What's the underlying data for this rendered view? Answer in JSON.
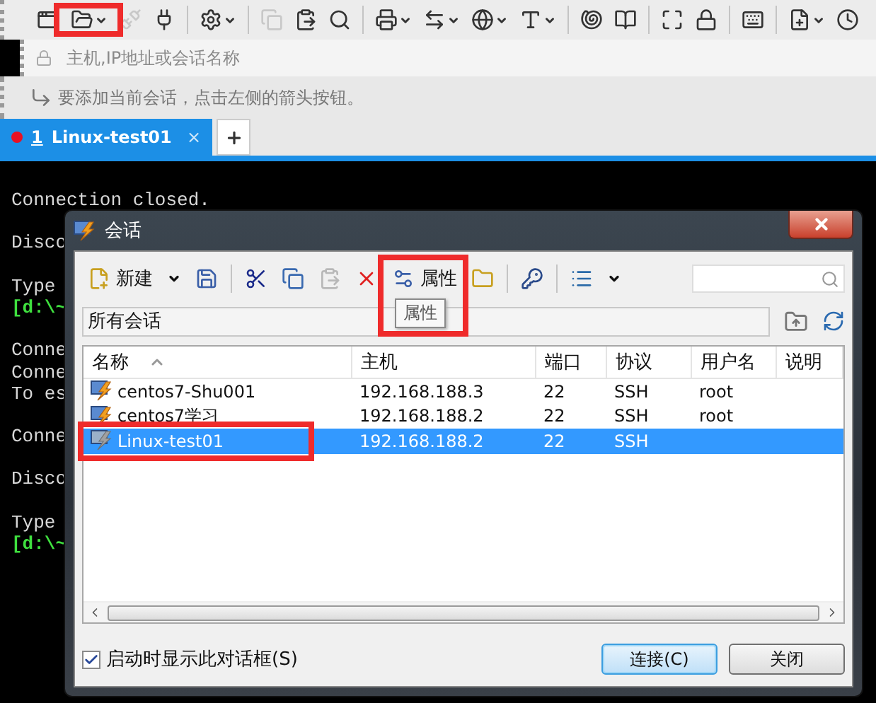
{
  "main_toolbar": [
    {
      "kind": "button",
      "disabled": false,
      "menu": false,
      "highlighted": false
    },
    {
      "kind": "button",
      "disabled": false,
      "menu": true,
      "highlighted": true
    },
    {
      "kind": "button",
      "disabled": true,
      "menu": false,
      "highlighted": false
    },
    {
      "kind": "button",
      "disabled": false,
      "menu": false,
      "highlighted": false
    },
    {
      "kind": "separator"
    },
    {
      "kind": "button",
      "disabled": false,
      "menu": true,
      "highlighted": false
    },
    {
      "kind": "separator"
    },
    {
      "kind": "button",
      "disabled": true,
      "menu": false,
      "highlighted": false
    },
    {
      "kind": "button",
      "disabled": false,
      "menu": false,
      "highlighted": false
    },
    {
      "kind": "button",
      "disabled": false,
      "menu": false,
      "highlighted": false
    },
    {
      "kind": "separator"
    },
    {
      "kind": "button",
      "disabled": false,
      "menu": true,
      "highlighted": false
    },
    {
      "kind": "button",
      "disabled": false,
      "menu": true,
      "highlighted": false
    },
    {
      "kind": "button",
      "disabled": false,
      "menu": true,
      "highlighted": false
    },
    {
      "kind": "button",
      "disabled": false,
      "menu": true,
      "highlighted": false
    },
    {
      "kind": "separator"
    },
    {
      "kind": "button",
      "disabled": false,
      "menu": false,
      "highlighted": false
    },
    {
      "kind": "button",
      "disabled": false,
      "menu": false,
      "highlighted": false
    },
    {
      "kind": "separator"
    },
    {
      "kind": "button",
      "disabled": false,
      "menu": false,
      "highlighted": false
    },
    {
      "kind": "button",
      "disabled": false,
      "menu": false,
      "highlighted": false
    },
    {
      "kind": "separator"
    },
    {
      "kind": "button",
      "disabled": false,
      "menu": false,
      "highlighted": false
    },
    {
      "kind": "separator"
    },
    {
      "kind": "button",
      "disabled": false,
      "menu": true,
      "highlighted": false
    },
    {
      "kind": "button",
      "disabled": false,
      "menu": false,
      "highlighted": false
    }
  ],
  "address_bar": {
    "placeholder": "主机,IP地址或会话名称"
  },
  "hint_bar": {
    "text": "要添加当前会话，点击左侧的箭头按钮。"
  },
  "tabs": [
    {
      "number": "1",
      "label": "Linux-test01",
      "close": "×",
      "selected": true,
      "disconnected": true
    }
  ],
  "terminal": {
    "lines": [
      {
        "kind": "text",
        "text": "Connection closed."
      },
      {
        "kind": "blank"
      },
      {
        "kind": "text",
        "text": "Disco"
      },
      {
        "kind": "blank"
      },
      {
        "kind": "text",
        "text": "Type"
      },
      {
        "kind": "prompt",
        "text": "[d:\\~"
      },
      {
        "kind": "blank"
      },
      {
        "kind": "text",
        "text": "Conne"
      },
      {
        "kind": "text",
        "text": "Conne"
      },
      {
        "kind": "text",
        "text": "To es"
      },
      {
        "kind": "blank"
      },
      {
        "kind": "text",
        "text": "Conne"
      },
      {
        "kind": "blank"
      },
      {
        "kind": "text",
        "text": "Disco"
      },
      {
        "kind": "blank"
      },
      {
        "kind": "text",
        "text": "Type"
      },
      {
        "kind": "prompt",
        "text": "[d:\\~"
      }
    ]
  },
  "dialog": {
    "title": "会话",
    "toolbar": [
      {
        "kind": "button",
        "label": "新建",
        "menu": true,
        "disabled": false,
        "highlighted": false
      },
      {
        "kind": "button",
        "disabled": false,
        "menu": false,
        "highlighted": false
      },
      {
        "kind": "separator"
      },
      {
        "kind": "button",
        "disabled": false,
        "menu": false,
        "highlighted": false
      },
      {
        "kind": "button",
        "disabled": false,
        "menu": false,
        "highlighted": false
      },
      {
        "kind": "button",
        "disabled": true,
        "menu": false,
        "highlighted": false
      },
      {
        "kind": "button",
        "disabled": false,
        "menu": false,
        "highlighted": false
      },
      {
        "kind": "button",
        "label": "属性",
        "disabled": false,
        "menu": false,
        "highlighted": true,
        "tooltip": "属性"
      },
      {
        "kind": "button",
        "disabled": false,
        "menu": false,
        "highlighted": false
      },
      {
        "kind": "separator"
      },
      {
        "kind": "button",
        "disabled": false,
        "menu": false,
        "highlighted": false
      },
      {
        "kind": "separator"
      },
      {
        "kind": "button",
        "disabled": false,
        "menu": true,
        "highlighted": false
      }
    ],
    "folder_path": "所有会话",
    "table": {
      "columns": [
        {
          "label": "名称",
          "sort_ascending": true
        },
        {
          "label": "主机",
          "sort_ascending": false
        },
        {
          "label": "端口",
          "sort_ascending": false
        },
        {
          "label": "协议",
          "sort_ascending": false
        },
        {
          "label": "用户名",
          "sort_ascending": false
        },
        {
          "label": "说明",
          "sort_ascending": false
        }
      ],
      "rows": [
        {
          "name": "centos7-Shu001",
          "host": "192.168.188.3",
          "port": "22",
          "protocol": "SSH",
          "user": "root",
          "selected": false,
          "highlighted": false
        },
        {
          "name": "centos7学习",
          "host": "192.168.188.2",
          "port": "22",
          "protocol": "SSH",
          "user": "root",
          "selected": false,
          "highlighted": false
        },
        {
          "name": "Linux-test01",
          "host": "192.168.188.2",
          "port": "22",
          "protocol": "SSH",
          "selected": true,
          "highlighted": true
        }
      ]
    },
    "show_on_startup": {
      "label": "启动时显示此对话框(S)",
      "checked": true
    },
    "buttons": [
      {
        "label": "连接(C)",
        "default": true
      },
      {
        "label": "关闭",
        "default": false
      }
    ]
  }
}
